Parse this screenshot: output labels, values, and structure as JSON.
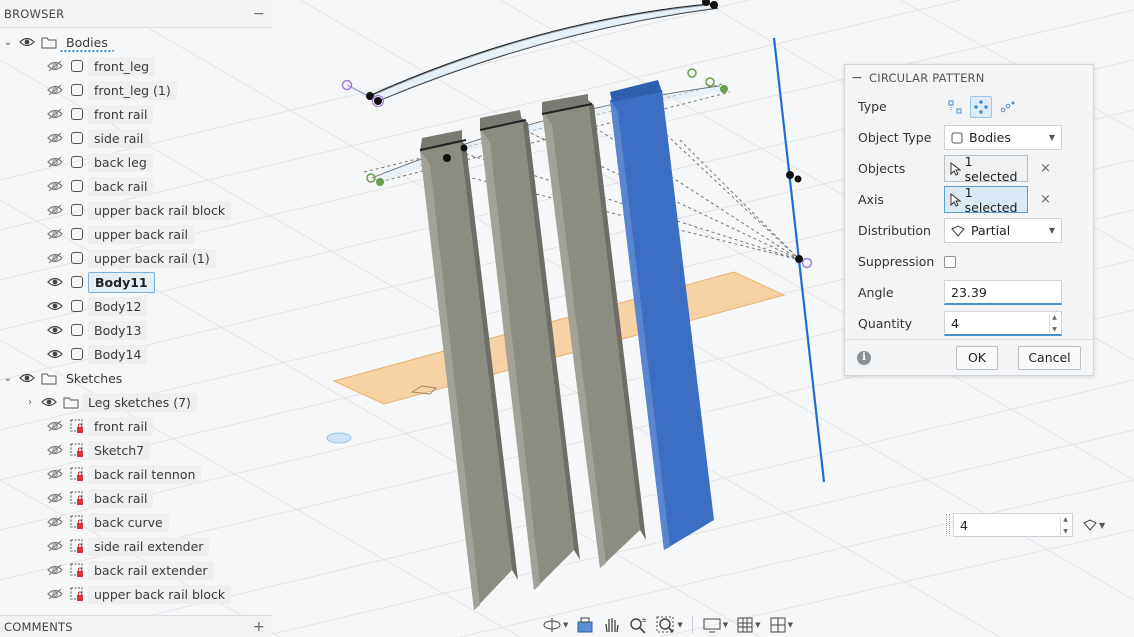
{
  "browser": {
    "title": "BROWSER",
    "collapse_icon": "minus-icon",
    "bodies_group": "Bodies",
    "bodies": [
      {
        "label": "front_leg",
        "visible": false
      },
      {
        "label": "front_leg (1)",
        "visible": false
      },
      {
        "label": "front rail",
        "visible": false
      },
      {
        "label": "side rail",
        "visible": false
      },
      {
        "label": "back leg",
        "visible": false
      },
      {
        "label": "back rail",
        "visible": false
      },
      {
        "label": "upper back rail block",
        "visible": false
      },
      {
        "label": "upper back rail",
        "visible": false
      },
      {
        "label": "upper back rail (1)",
        "visible": false
      },
      {
        "label": "Body11",
        "visible": true,
        "selected": true
      },
      {
        "label": "Body12",
        "visible": true
      },
      {
        "label": "Body13",
        "visible": true
      },
      {
        "label": "Body14",
        "visible": true
      }
    ],
    "sketches_group": "Sketches",
    "sketch_folder": "Leg sketches (7)",
    "sketches": [
      {
        "label": "front rail"
      },
      {
        "label": "Sketch7"
      },
      {
        "label": "back rail tennon"
      },
      {
        "label": "back rail"
      },
      {
        "label": "back curve"
      },
      {
        "label": "side rail extender"
      },
      {
        "label": "back rail extender"
      },
      {
        "label": "upper back rail block"
      }
    ]
  },
  "comments": {
    "title": "COMMENTS",
    "add_icon": "plus-icon"
  },
  "dialog": {
    "title": "CIRCULAR PATTERN",
    "type_label": "Type",
    "object_type_label": "Object Type",
    "object_type_value": "Bodies",
    "objects_label": "Objects",
    "objects_value": "1 selected",
    "axis_label": "Axis",
    "axis_value": "1 selected",
    "distribution_label": "Distribution",
    "distribution_value": "Partial",
    "suppression_label": "Suppression",
    "suppression_checked": false,
    "angle_label": "Angle",
    "angle_value": "23.39",
    "quantity_label": "Quantity",
    "quantity_value": "4",
    "ok_label": "OK",
    "cancel_label": "Cancel"
  },
  "floating_quantity": {
    "value": "4"
  },
  "colors": {
    "accent_blue": "#3b6fc4",
    "body_gray": "#8b8b82",
    "plane_orange": "#f5c68a",
    "axis_blue": "#1c6fd1",
    "selection_outline": "#7fb1da"
  },
  "toolbar": {
    "icons": [
      "orbit-icon",
      "look-at-icon",
      "pan-icon",
      "zoom-icon",
      "fit-icon",
      "display-settings-icon",
      "grid-icon",
      "viewports-icon"
    ]
  }
}
